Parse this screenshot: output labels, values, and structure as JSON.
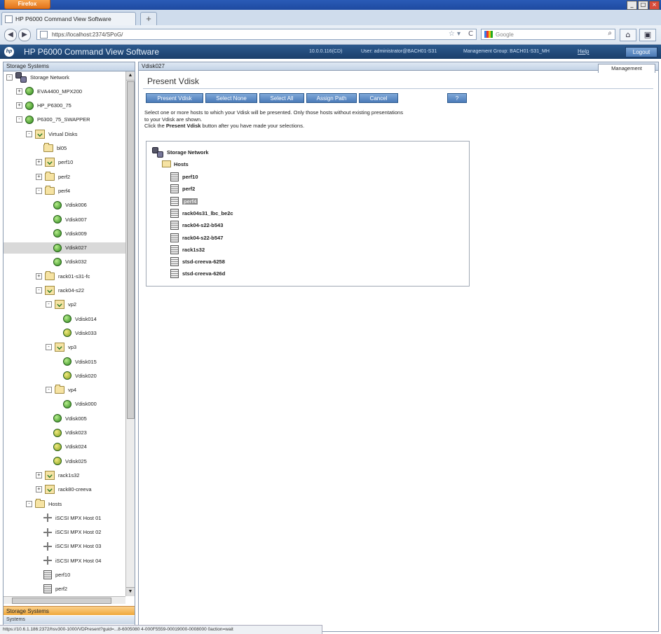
{
  "browser": {
    "app_button": "Firefox",
    "tab_title": "HP P6000 Command View Software",
    "url": "https://localhost:2374/SPoG/",
    "search_placeholder": "Google",
    "status_url": "https://10.6.1.186:2372/hsv300-1000/VDPresent?guid=...8-6005080 4-000F5559-00019000-0008000 0action=wait"
  },
  "app": {
    "title": "HP P6000 Command View Software",
    "ip": "10.0.0.116(CD)",
    "user": "User: administrator@BACH01-S31",
    "mgmt_group": "Management Group: BACH01-S31_MH",
    "help": "Help",
    "logout": "Logout"
  },
  "left": {
    "header": "Storage Systems",
    "bottom_tab": "Storage Systems",
    "bottom_tab2": "Systems",
    "tree": [
      {
        "label": "Storage Network",
        "icon": "network-icon",
        "indent": 0,
        "exp": "-"
      },
      {
        "label": "EVA4400_MPX200",
        "icon": "array-icon",
        "indent": 1,
        "exp": "+"
      },
      {
        "label": "HP_P6300_75",
        "icon": "array-icon",
        "indent": 1,
        "exp": "+"
      },
      {
        "label": "P6300_75_SWAPPER",
        "icon": "array-icon",
        "indent": 1,
        "exp": "-"
      },
      {
        "label": "Virtual Disks",
        "icon": "virtual-folder-icon",
        "indent": 2,
        "exp": "-"
      },
      {
        "label": "bl05",
        "icon": "folder-icon",
        "indent": 3,
        "exp": ""
      },
      {
        "label": "perf10",
        "icon": "virtual-folder-icon",
        "indent": 3,
        "exp": "+"
      },
      {
        "label": "perf2",
        "icon": "folder-icon",
        "indent": 3,
        "exp": "+"
      },
      {
        "label": "perf4",
        "icon": "folder-icon",
        "indent": 3,
        "exp": "-"
      },
      {
        "label": "Vdisk006",
        "icon": "vdisk-icon",
        "indent": 4,
        "exp": ""
      },
      {
        "label": "Vdisk007",
        "icon": "vdisk-icon",
        "indent": 4,
        "exp": ""
      },
      {
        "label": "Vdisk009",
        "icon": "vdisk-icon",
        "indent": 4,
        "exp": ""
      },
      {
        "label": "Vdisk027",
        "icon": "vdisk-icon",
        "indent": 4,
        "exp": "",
        "selected": true
      },
      {
        "label": "Vdisk032",
        "icon": "vdisk-icon",
        "indent": 4,
        "exp": ""
      },
      {
        "label": "rack01-s31-fc",
        "icon": "folder-icon",
        "indent": 3,
        "exp": "+"
      },
      {
        "label": "rack04-s22",
        "icon": "virtual-folder-icon",
        "indent": 3,
        "exp": "-"
      },
      {
        "label": "vp2",
        "icon": "virtual-folder-icon",
        "indent": 4,
        "exp": "-"
      },
      {
        "label": "Vdisk014",
        "icon": "vdisk-icon",
        "indent": 5,
        "exp": ""
      },
      {
        "label": "Vdisk033",
        "icon": "vdisk-warn-icon",
        "indent": 5,
        "exp": ""
      },
      {
        "label": "vp3",
        "icon": "virtual-folder-icon",
        "indent": 4,
        "exp": "-"
      },
      {
        "label": "Vdisk015",
        "icon": "vdisk-icon",
        "indent": 5,
        "exp": ""
      },
      {
        "label": "Vdisk020",
        "icon": "vdisk-warn-icon",
        "indent": 5,
        "exp": ""
      },
      {
        "label": "vp4",
        "icon": "folder-icon",
        "indent": 4,
        "exp": "-"
      },
      {
        "label": "Vdisk000",
        "icon": "vdisk-icon",
        "indent": 5,
        "exp": ""
      },
      {
        "label": "Vdisk005",
        "icon": "vdisk-icon",
        "indent": 4,
        "exp": ""
      },
      {
        "label": "Vdisk023",
        "icon": "vdisk-warn-icon",
        "indent": 4,
        "exp": ""
      },
      {
        "label": "Vdisk024",
        "icon": "vdisk-warn-icon",
        "indent": 4,
        "exp": ""
      },
      {
        "label": "Vdisk025",
        "icon": "vdisk-warn-icon",
        "indent": 4,
        "exp": ""
      },
      {
        "label": "rack1s32",
        "icon": "virtual-folder-icon",
        "indent": 3,
        "exp": "+"
      },
      {
        "label": "rack80-creeva",
        "icon": "virtual-folder-icon",
        "indent": 3,
        "exp": "+"
      },
      {
        "label": "Hosts",
        "icon": "folder-icon",
        "indent": 2,
        "exp": "-"
      },
      {
        "label": "iSCSI MPX Host 01",
        "icon": "iscsi-host-icon",
        "indent": 3,
        "exp": ""
      },
      {
        "label": "iSCSI MPX Host 02",
        "icon": "iscsi-host-icon",
        "indent": 3,
        "exp": ""
      },
      {
        "label": "iSCSI MPX Host 03",
        "icon": "iscsi-host-icon",
        "indent": 3,
        "exp": ""
      },
      {
        "label": "iSCSI MPX Host 04",
        "icon": "iscsi-host-icon",
        "indent": 3,
        "exp": ""
      },
      {
        "label": "perf10",
        "icon": "host-icon",
        "indent": 3,
        "exp": ""
      },
      {
        "label": "perf2",
        "icon": "host-icon",
        "indent": 3,
        "exp": ""
      }
    ]
  },
  "right": {
    "header": "Vdisk027",
    "tab": "Management",
    "title": "Present Vdisk",
    "buttons": [
      "Present Vdisk",
      "Select None",
      "Select All",
      "Assign Path",
      "Cancel",
      "?"
    ],
    "instruction1": "Select one or more hosts to which your Vdisk will be presented. Only those hosts without existing presentations",
    "instruction2": "to your Vdisk are shown.",
    "instruction3_pre": "Click the ",
    "instruction3_bold": "Present Vdisk",
    "instruction3_post": " button after you have made your selections.",
    "network_label": "Storage Network",
    "hosts_label": "Hosts",
    "hosts": [
      {
        "label": "perf10"
      },
      {
        "label": "perf2"
      },
      {
        "label": "perf4",
        "selected": true
      },
      {
        "label": "rack04s31_lbc_be2c"
      },
      {
        "label": "rack04-s22-b543"
      },
      {
        "label": "rack04-s22-b547"
      },
      {
        "label": "rack1s32"
      },
      {
        "label": "stsd-creeva-6258"
      },
      {
        "label": "stsd-creeva-626d"
      }
    ]
  }
}
